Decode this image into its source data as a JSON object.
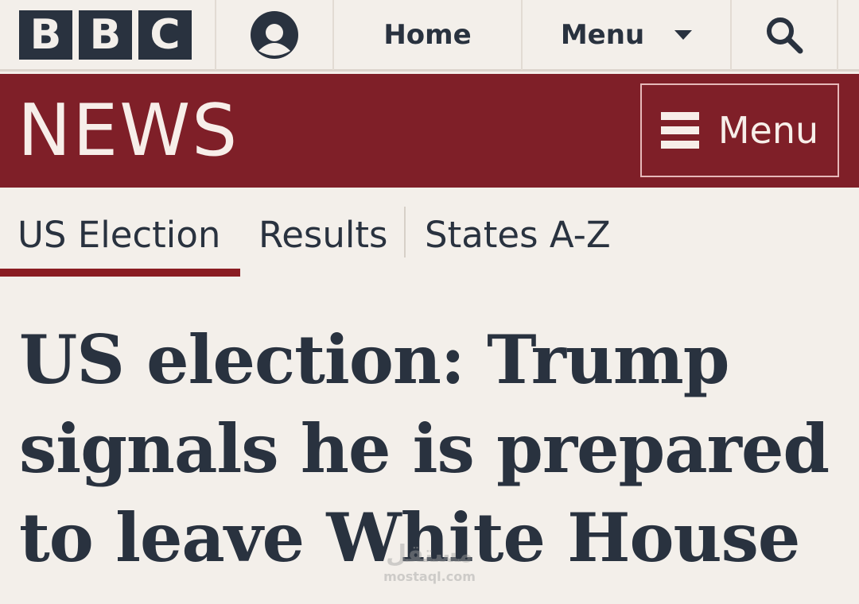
{
  "brand": {
    "logo_letters": [
      "B",
      "B",
      "C"
    ],
    "colors": {
      "news_bar": "#7f1f28",
      "text": "#29323f",
      "background": "#f3efea",
      "underline": "#8a1c22"
    }
  },
  "topnav": {
    "account_icon": "account-icon",
    "home_label": "Home",
    "menu_label": "Menu",
    "menu_icon": "chevron-down-icon",
    "search_icon": "search-icon"
  },
  "newsbar": {
    "title": "NEWS",
    "menu_label": "Menu",
    "menu_icon": "hamburger-icon"
  },
  "section_nav": {
    "items": [
      {
        "label": "US Election",
        "active": true
      },
      {
        "label": "Results",
        "active": false
      },
      {
        "label": "States A-Z",
        "active": false
      }
    ]
  },
  "article": {
    "headline": "US election: Trump signals he is prepared to leave White House"
  },
  "watermark": {
    "arabic": "مستقل",
    "latin": "mostaql.com"
  }
}
